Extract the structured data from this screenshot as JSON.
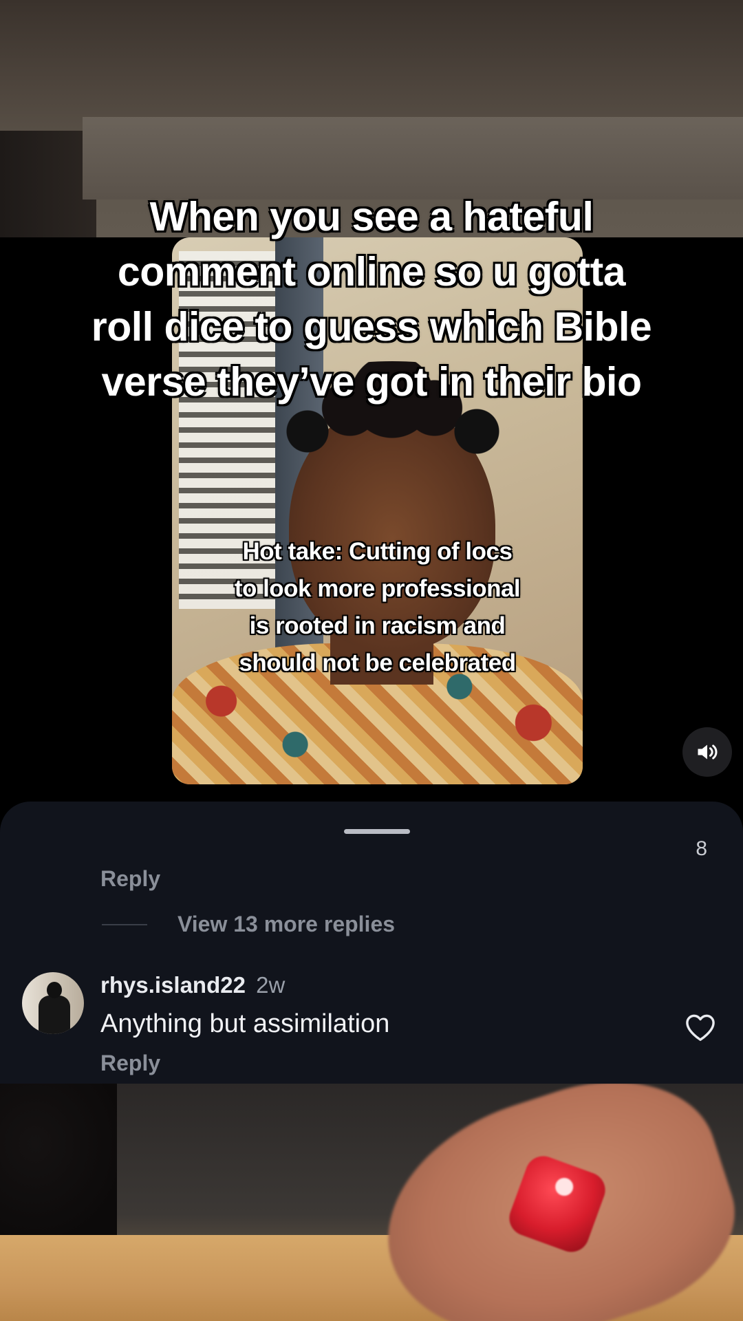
{
  "overlay": {
    "main_caption_lines": [
      "When you see a hateful",
      "comment online so u gotta",
      "roll dice to guess which Bible",
      "verse they’ve got in their bio"
    ]
  },
  "video": {
    "caption_lines": [
      "Hot take: Cutting of locs",
      "to look more professional",
      "is rooted in racism and",
      "should not be celebrated"
    ]
  },
  "controls": {
    "sound_icon": "speaker-volume-icon"
  },
  "comments": {
    "previous": {
      "like_count": "8",
      "reply_label": "Reply"
    },
    "view_more_label": "View 13 more replies",
    "comment": {
      "username": "rhys.island22",
      "time": "2w",
      "text": "Anything but assimilation",
      "reply_label": "Reply",
      "like_icon": "heart-outline-icon"
    }
  },
  "colors": {
    "sheet_bg": "#11141c",
    "muted_text": "#8a8f99",
    "primary_text": "#f1f2f5"
  }
}
